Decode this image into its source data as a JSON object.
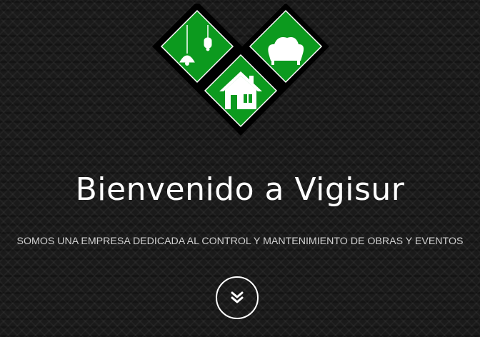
{
  "hero": {
    "title": "Bienvenido a Vigisur",
    "subtitle": "SOMOS UNA EMPRESA DEDICADA AL CONTROL Y MANTENIMIENTO DE OBRAS Y EVENTOS",
    "scroll_button_icon": "double-chevron-down-icon"
  },
  "logo": {
    "tiles": [
      "lamp-icon",
      "sofa-icon",
      "house-icon"
    ]
  },
  "colors": {
    "background": "#1a1a1a",
    "logo_green": "#0c9a1e",
    "logo_border": "#000000",
    "text": "#ffffff",
    "subtitle": "#d2d2d2"
  }
}
